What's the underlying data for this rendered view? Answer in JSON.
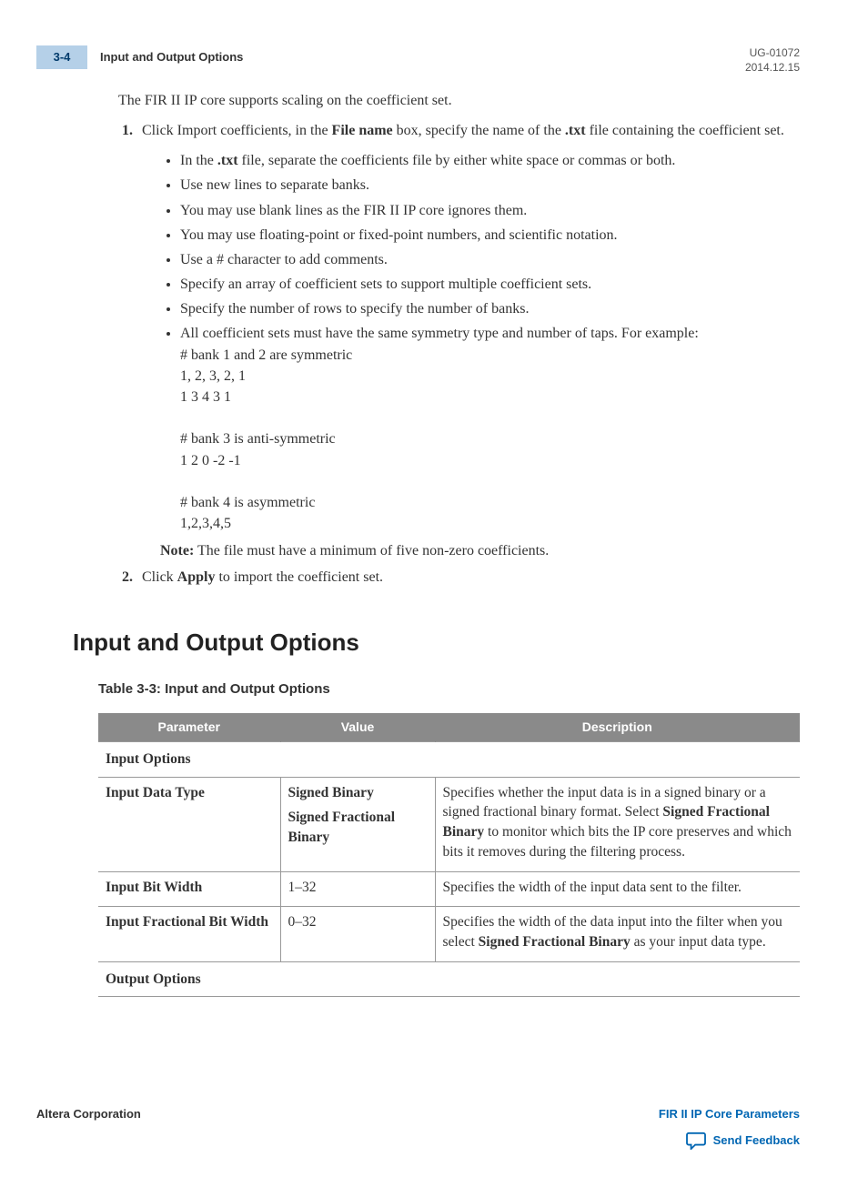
{
  "header": {
    "page_number": "3-4",
    "running_title": "Input and Output Options",
    "doc_id": "UG-01072",
    "date": "2014.12.15"
  },
  "content": {
    "intro": "The FIR II IP core supports scaling on the coefficient set.",
    "step1_pre": "Click Import coefficients, in the ",
    "step1_bold1": "File name",
    "step1_mid": " box, specify the name of the ",
    "step1_bold2": ".txt",
    "step1_post": " file containing the coefficient set.",
    "bullets": {
      "b1_pre": "In the ",
      "b1_bold": ".txt",
      "b1_post": " file, separate the coefficients file by either white space or commas or both.",
      "b2": "Use new lines to separate banks.",
      "b3": "You may use blank lines as the FIR II IP core ignores them.",
      "b4": "You may use floating-point or fixed-point numbers, and scientific notation.",
      "b5": "Use a # character to add comments.",
      "b6": "Specify an array of coefficient sets to support multiple coefficient sets.",
      "b7": "Specify the number of rows to specify the number of banks.",
      "b8_lead": "All coefficient sets must have the same symmetry type and number of taps. For example:",
      "b8_code1": "# bank 1 and 2 are symmetric\n1, 2, 3, 2, 1\n1 3 4 3 1",
      "b8_code2": "# bank 3 is anti-symmetric\n1 2 0 -2 -1",
      "b8_code3": "# bank 4 is asymmetric\n1,2,3,4,5"
    },
    "note_label": "Note:",
    "note_text": "The file must have a minimum of five non-zero coefficients.",
    "step2_pre": "Click ",
    "step2_bold": "Apply",
    "step2_post": " to import the coefficient set."
  },
  "section": {
    "heading": "Input and Output Options",
    "table_caption": "Table 3-3: Input and Output Options",
    "columns": {
      "param": "Parameter",
      "value": "Value",
      "desc": "Description"
    },
    "group1": "Input Options",
    "rows": [
      {
        "param": "Input Data Type",
        "value_l1": "Signed Binary",
        "value_l2": "Signed Fractional Binary",
        "desc_pre": "Specifies whether the input data is in a signed binary or a signed fractional binary format. Select ",
        "desc_bold": "Signed Fractional Binary",
        "desc_post": " to monitor which bits the IP core preserves and which bits it removes during the filtering process."
      },
      {
        "param": "Input Bit Width",
        "value_l1": "1–32",
        "desc": "Specifies the width of the input data sent to the filter."
      },
      {
        "param": "Input Fractional Bit Width",
        "value_l1": "0–32",
        "desc_pre": "Specifies the width of the data input into the filter when you select ",
        "desc_bold": "Signed Fractional Binary",
        "desc_post": " as your input data type."
      }
    ],
    "group2": "Output Options"
  },
  "footer": {
    "corp": "Altera Corporation",
    "chapter_link": "FIR II IP Core Parameters",
    "feedback": "Send Feedback"
  }
}
